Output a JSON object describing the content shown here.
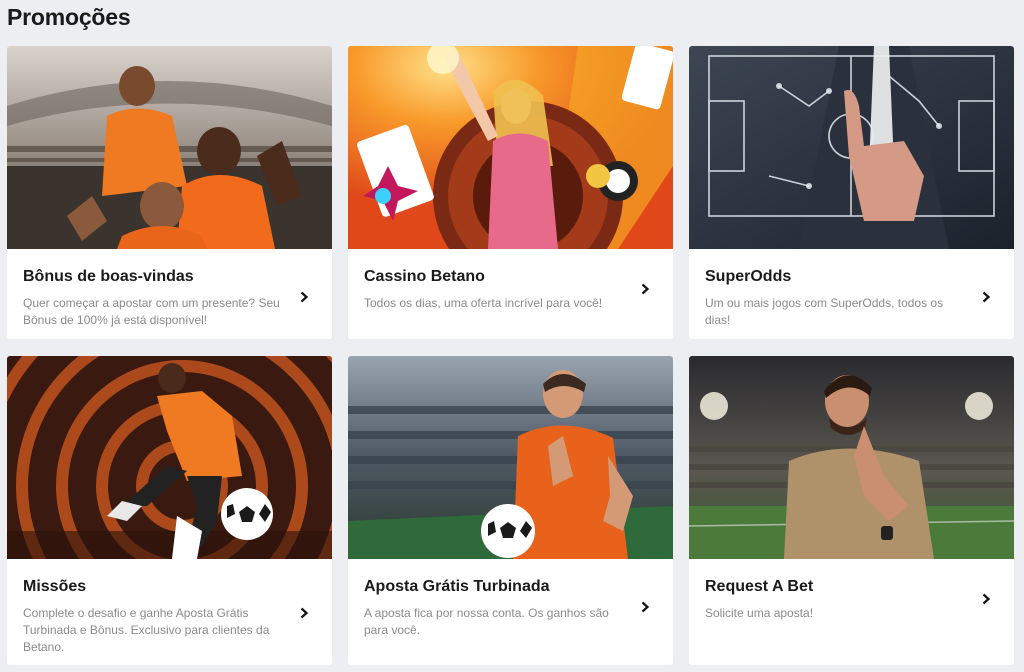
{
  "page": {
    "title": "Promoções"
  },
  "promotions": [
    {
      "title": "Bônus de boas-vindas",
      "description": "Quer começar a apostar com um presente? Seu Bônus de 100% já está disponível!",
      "image": "celebrating-fans-stadium",
      "icon": "chevron-right-icon"
    },
    {
      "title": "Cassino Betano",
      "description": "Todos os dias, uma oferta incrível para você!",
      "image": "casino-roulette-woman",
      "icon": "chevron-right-icon"
    },
    {
      "title": "SuperOdds",
      "description": "Um ou mais jogos com SuperOdds, todos os dias!",
      "image": "tactics-board-hand",
      "icon": "chevron-right-icon"
    },
    {
      "title": "Missões",
      "description": "Complete o desafio e ganhe Aposta Grátis Turbinada e Bônus. Exclusivo para clientes da Betano.",
      "image": "player-kicking-ball-target",
      "icon": "chevron-right-icon"
    },
    {
      "title": "Aposta Grátis Turbinada",
      "description": "A aposta fica por nossa conta. Os ganhos são para você.",
      "image": "player-holding-ball-stadium",
      "icon": "chevron-right-icon"
    },
    {
      "title": "Request A Bet",
      "description": "Solicite uma aposta!",
      "image": "thinking-man-stadium",
      "icon": "chevron-right-icon"
    }
  ],
  "colors": {
    "background": "#eceef2",
    "card": "#ffffff",
    "title": "#1b1b1b",
    "description": "#8a8a8a",
    "brand_orange": "#f26b1d"
  }
}
